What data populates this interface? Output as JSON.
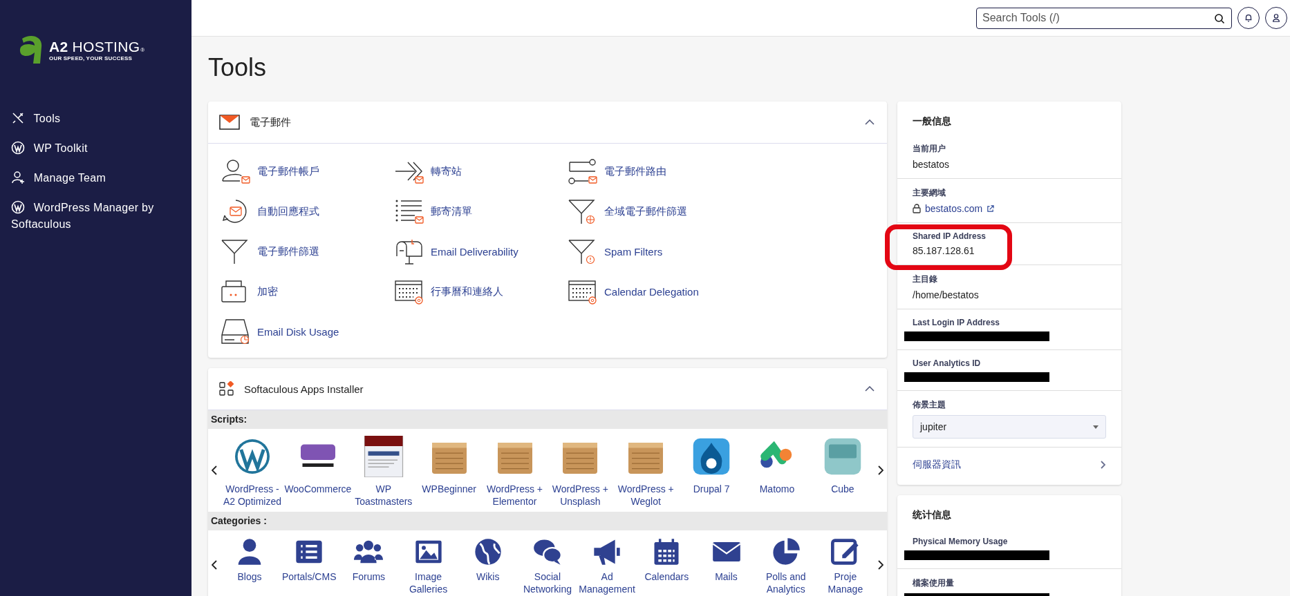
{
  "brand": {
    "name": "**A2** HOSTING",
    "mark": "®",
    "tagline": "OUR SPEED, YOUR SUCCESS"
  },
  "search": {
    "placeholder": "Search Tools (/)"
  },
  "sidebar": {
    "items": [
      {
        "label": "Tools",
        "kind": "tools"
      },
      {
        "label": "WP Toolkit",
        "kind": "wordpress"
      },
      {
        "label": "Manage Team",
        "kind": "team"
      },
      {
        "label": "WordPress Manager by Softaculous",
        "kind": "wordpress"
      }
    ]
  },
  "page_title": "Tools",
  "email_section": {
    "title": "電子郵件",
    "expanded": true,
    "tools": [
      {
        "label": "電子郵件帳戶",
        "kind": "account"
      },
      {
        "label": "轉寄站",
        "kind": "forward"
      },
      {
        "label": "電子郵件路由",
        "kind": "route"
      },
      {
        "label": "自動回應程式",
        "kind": "responder"
      },
      {
        "label": "郵寄清單",
        "kind": "list"
      },
      {
        "label": "全域電子郵件篩選",
        "kind": "funnel-globe"
      },
      {
        "label": "電子郵件篩選",
        "kind": "funnel"
      },
      {
        "label": "Email Deliverability",
        "kind": "mailbox"
      },
      {
        "label": "Spam Filters",
        "kind": "funnel-alert"
      },
      {
        "label": "加密",
        "kind": "case"
      },
      {
        "label": "行事曆和連絡人",
        "kind": "calendar-at"
      },
      {
        "label": "Calendar Delegation",
        "kind": "calendar-gear"
      },
      {
        "label": "Email Disk Usage",
        "kind": "disk"
      }
    ]
  },
  "softaculous": {
    "title": "Softaculous Apps Installer",
    "expanded": true,
    "scripts_label": "Scripts:",
    "categories_label": "Categories :",
    "scripts": [
      {
        "label": "WordPress - A2 Optimized",
        "kind": "wordpress"
      },
      {
        "label": "WooCommerce",
        "kind": "woo"
      },
      {
        "label": "WP Toastmasters",
        "kind": "screenshot"
      },
      {
        "label": "WPBeginner",
        "kind": "crate"
      },
      {
        "label": "WordPress + Elementor",
        "kind": "crate"
      },
      {
        "label": "WordPress + Unsplash",
        "kind": "crate"
      },
      {
        "label": "WordPress + Weglot",
        "kind": "crate"
      },
      {
        "label": "Drupal 7",
        "kind": "drupal"
      },
      {
        "label": "Matomo",
        "kind": "matomo"
      },
      {
        "label": "Cube",
        "kind": "cube"
      }
    ],
    "categories": [
      {
        "label": "Blogs",
        "kind": "person"
      },
      {
        "label": "Portals/CMS",
        "kind": "list"
      },
      {
        "label": "Forums",
        "kind": "people"
      },
      {
        "label": "Image Galleries",
        "kind": "image"
      },
      {
        "label": "Wikis",
        "kind": "globe"
      },
      {
        "label": "Social Networking",
        "kind": "chat"
      },
      {
        "label": "Ad Management",
        "kind": "megaphone"
      },
      {
        "label": "Calendars",
        "kind": "calendar"
      },
      {
        "label": "Mails",
        "kind": "mail"
      },
      {
        "label": "Polls and Analytics",
        "kind": "pie"
      },
      {
        "label": "Proje Manage",
        "kind": "edit"
      }
    ]
  },
  "general_info": {
    "title": "一般信息",
    "fields": [
      {
        "label": "当前用户",
        "value": "bestatos",
        "kind": "text",
        "highlighted": false
      },
      {
        "label": "主要網域",
        "value": "bestatos.com",
        "kind": "link",
        "highlighted": false
      },
      {
        "label": "Shared IP Address",
        "value": "85.187.128.61",
        "kind": "text",
        "highlighted": true
      },
      {
        "label": "主目錄",
        "value": "/home/bestatos",
        "kind": "text",
        "highlighted": false
      },
      {
        "label": "Last Login IP Address",
        "kind": "redacted",
        "highlighted": false
      },
      {
        "label": "User Analytics ID",
        "kind": "redacted",
        "highlighted": false
      },
      {
        "label": "佈景主題",
        "value": "jupiter",
        "kind": "select",
        "highlighted": false
      }
    ],
    "link": "伺服器資訊"
  },
  "stats": {
    "title": "统计信息",
    "fields": [
      {
        "label": "Physical Memory Usage",
        "kind": "redacted"
      },
      {
        "label": "檔案使用量",
        "kind": "redacted"
      }
    ]
  }
}
